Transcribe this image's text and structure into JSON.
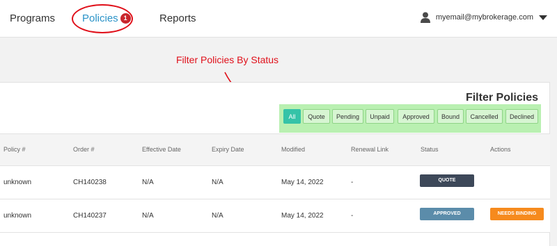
{
  "nav": {
    "programs": "Programs",
    "policies": "Policies",
    "policies_badge": "1",
    "reports": "Reports"
  },
  "user": {
    "email": "myemail@mybrokerage.com"
  },
  "annotation": "Filter Policies By Status",
  "panel": {
    "title": "Filter Policies"
  },
  "filters": [
    "All",
    "Quote",
    "Pending",
    "Unpaid",
    "Approved",
    "Bound",
    "Cancelled",
    "Declined"
  ],
  "active_filter": "All",
  "table": {
    "headers": [
      "Policy #",
      "Order #",
      "Effective Date",
      "Expiry Date",
      "Modified",
      "Renewal Link",
      "Status",
      "Actions"
    ],
    "rows": [
      {
        "policy": "unknown",
        "order": "CH140238",
        "effective": "N/A",
        "expiry": "N/A",
        "modified": "May 14, 2022",
        "renewal": "-",
        "status": "QUOTE",
        "action": ""
      },
      {
        "policy": "unknown",
        "order": "CH140237",
        "effective": "N/A",
        "expiry": "N/A",
        "modified": "May 14, 2022",
        "renewal": "-",
        "status": "APPROVED",
        "action": "NEEDS BINDING"
      }
    ]
  },
  "colors": {
    "accent": "#2b93c8",
    "badge": "#c9252c",
    "annotation": "#e0101a",
    "filter_bg": "#b9f0b1",
    "filter_active": "#35c3a8",
    "status_quote": "#3d4859",
    "status_approved": "#5b8caa",
    "action_needs_binding": "#f68a1d"
  },
  "icons": {
    "user": "user-icon",
    "menu": "caret-down-icon"
  }
}
